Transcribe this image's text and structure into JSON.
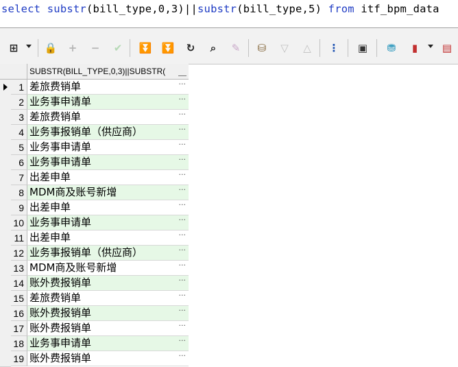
{
  "editor": {
    "sql_tokens": [
      {
        "text": "select",
        "kind": "kw"
      },
      {
        "text": " ",
        "kind": "tx"
      },
      {
        "text": "substr",
        "kind": "fn"
      },
      {
        "text": "(bill_type,0,3)||",
        "kind": "tx"
      },
      {
        "text": "substr",
        "kind": "fn"
      },
      {
        "text": "(bill_type,5) ",
        "kind": "tx"
      },
      {
        "text": "from",
        "kind": "kw"
      },
      {
        "text": " itf_bpm_data",
        "kind": "tx"
      }
    ]
  },
  "toolbar": {
    "icons": [
      {
        "name": "grid-options-icon",
        "glyph": "⊞",
        "color": "#222222",
        "interactable": true
      },
      {
        "name": "lock-icon",
        "glyph": "🔒",
        "color": "#555555",
        "interactable": true
      },
      {
        "name": "add-record-icon",
        "glyph": "+",
        "color": "#b5b5b5",
        "interactable": false
      },
      {
        "name": "delete-record-icon",
        "glyph": "−",
        "color": "#b5b5b5",
        "interactable": false
      },
      {
        "name": "post-changes-icon",
        "glyph": "✔",
        "color": "#b5d9b5",
        "interactable": false
      },
      {
        "name": "fetch-next-page-icon",
        "glyph": "⏬",
        "color": "#1d9a36",
        "interactable": true
      },
      {
        "name": "fetch-last-page-icon",
        "glyph": "⏬",
        "color": "#1d9a36",
        "interactable": true
      },
      {
        "name": "refresh-icon",
        "glyph": "↻",
        "color": "#222222",
        "interactable": true
      },
      {
        "name": "find-binoculars-icon",
        "glyph": "⌕",
        "color": "#222222",
        "interactable": true
      },
      {
        "name": "clear-eraser-icon",
        "glyph": "✎",
        "color": "#c9a9c9",
        "interactable": false
      },
      {
        "name": "query-by-example-icon",
        "glyph": "⛁",
        "color": "#7a5a2a",
        "interactable": true
      },
      {
        "name": "previous-record-icon",
        "glyph": "▽",
        "color": "#c0c0c0",
        "interactable": false
      },
      {
        "name": "next-record-icon",
        "glyph": "△",
        "color": "#c0c0c0",
        "interactable": false
      },
      {
        "name": "explain-plan-icon",
        "glyph": "⋮",
        "color": "#1a4fb0",
        "interactable": true
      },
      {
        "name": "save-icon",
        "glyph": "▣",
        "color": "#333333",
        "interactable": true
      },
      {
        "name": "export-icon",
        "glyph": "⛃",
        "color": "#1a8fb8",
        "interactable": true
      },
      {
        "name": "chart-icon",
        "glyph": "▮",
        "color": "#c23030",
        "interactable": true
      },
      {
        "name": "single-record-view-icon",
        "glyph": "▤",
        "color": "#c23030",
        "interactable": true
      }
    ]
  },
  "grid": {
    "column_header": "SUBSTR(BILL_TYPE,0,3)||SUBSTR(",
    "rows": [
      {
        "num": "1",
        "value": "差旅费销单"
      },
      {
        "num": "2",
        "value": "业务事申请单"
      },
      {
        "num": "3",
        "value": "差旅费销单"
      },
      {
        "num": "4",
        "value": "业务事报销单（供应商）"
      },
      {
        "num": "5",
        "value": "业务事申请单"
      },
      {
        "num": "6",
        "value": "业务事申请单"
      },
      {
        "num": "7",
        "value": "出差申单"
      },
      {
        "num": "8",
        "value": "MDM商及账号新增"
      },
      {
        "num": "9",
        "value": "出差申单"
      },
      {
        "num": "10",
        "value": "业务事申请单"
      },
      {
        "num": "11",
        "value": "出差申单"
      },
      {
        "num": "12",
        "value": "业务事报销单（供应商）"
      },
      {
        "num": "13",
        "value": "MDM商及账号新增"
      },
      {
        "num": "14",
        "value": "账外费报销单"
      },
      {
        "num": "15",
        "value": "差旅费销单"
      },
      {
        "num": "16",
        "value": "账外费报销单"
      },
      {
        "num": "17",
        "value": "账外费报销单"
      },
      {
        "num": "18",
        "value": "业务事申请单"
      },
      {
        "num": "19",
        "value": "账外费报销单"
      }
    ],
    "ellipsis": "···"
  }
}
